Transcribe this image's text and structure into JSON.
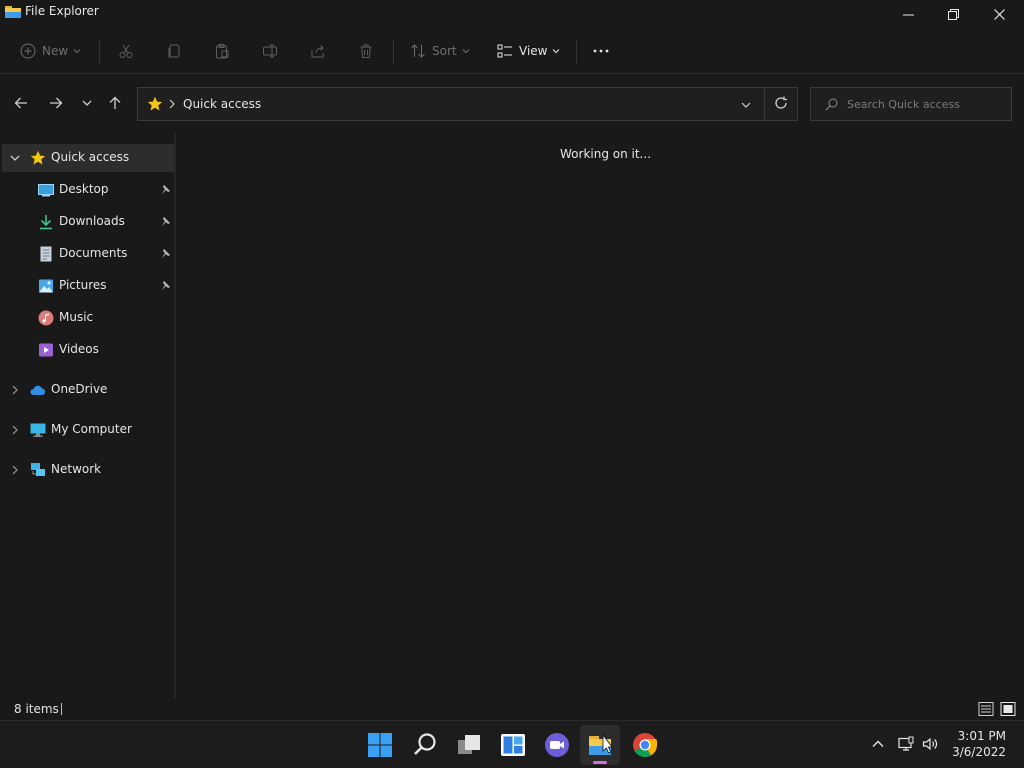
{
  "window": {
    "title": "File Explorer",
    "controls": {
      "minimize": "minimize-icon",
      "restore": "restore-icon",
      "close": "close-icon"
    }
  },
  "commandbar": {
    "new_label": "New",
    "sort_label": "Sort",
    "view_label": "View",
    "icons": [
      "plus-icon",
      "cut-icon",
      "copy-icon",
      "paste-icon",
      "rename-icon",
      "share-icon",
      "delete-icon",
      "sort-icon",
      "view-icon",
      "more-icon"
    ]
  },
  "address": {
    "path_label": "Quick access"
  },
  "search": {
    "placeholder": "Search Quick access",
    "value": ""
  },
  "sidebar": {
    "items": [
      {
        "label": "Quick access",
        "icon": "star-icon",
        "selected": true,
        "expanded": true
      },
      {
        "label": "Desktop",
        "icon": "desktop-icon",
        "pinned": true
      },
      {
        "label": "Downloads",
        "icon": "download-icon",
        "pinned": true
      },
      {
        "label": "Documents",
        "icon": "document-icon",
        "pinned": true
      },
      {
        "label": "Pictures",
        "icon": "pictures-icon",
        "pinned": true
      },
      {
        "label": "Music",
        "icon": "music-icon",
        "pinned": false
      },
      {
        "label": "Videos",
        "icon": "videos-icon",
        "pinned": false
      },
      {
        "label": "OneDrive",
        "icon": "cloud-icon",
        "expanded": false
      },
      {
        "label": "My Computer",
        "icon": "computer-icon",
        "expanded": false
      },
      {
        "label": "Network",
        "icon": "network-icon",
        "expanded": false
      }
    ]
  },
  "content": {
    "message": "Working on it..."
  },
  "statusbar": {
    "items_count": "8 items"
  },
  "taskbar": {
    "apps": [
      "windows-start-icon",
      "search-icon",
      "task-view-icon",
      "widgets-icon",
      "chat-icon",
      "file-explorer-icon",
      "chrome-icon"
    ],
    "active_app": "file-explorer-icon",
    "time": "3:01 PM",
    "date": "3/6/2022"
  },
  "colors": {
    "background": "#191919",
    "accent_star": "#f5c518",
    "taskbar_indicator": "#d272e0",
    "start_blue": "#3aa0f3"
  }
}
